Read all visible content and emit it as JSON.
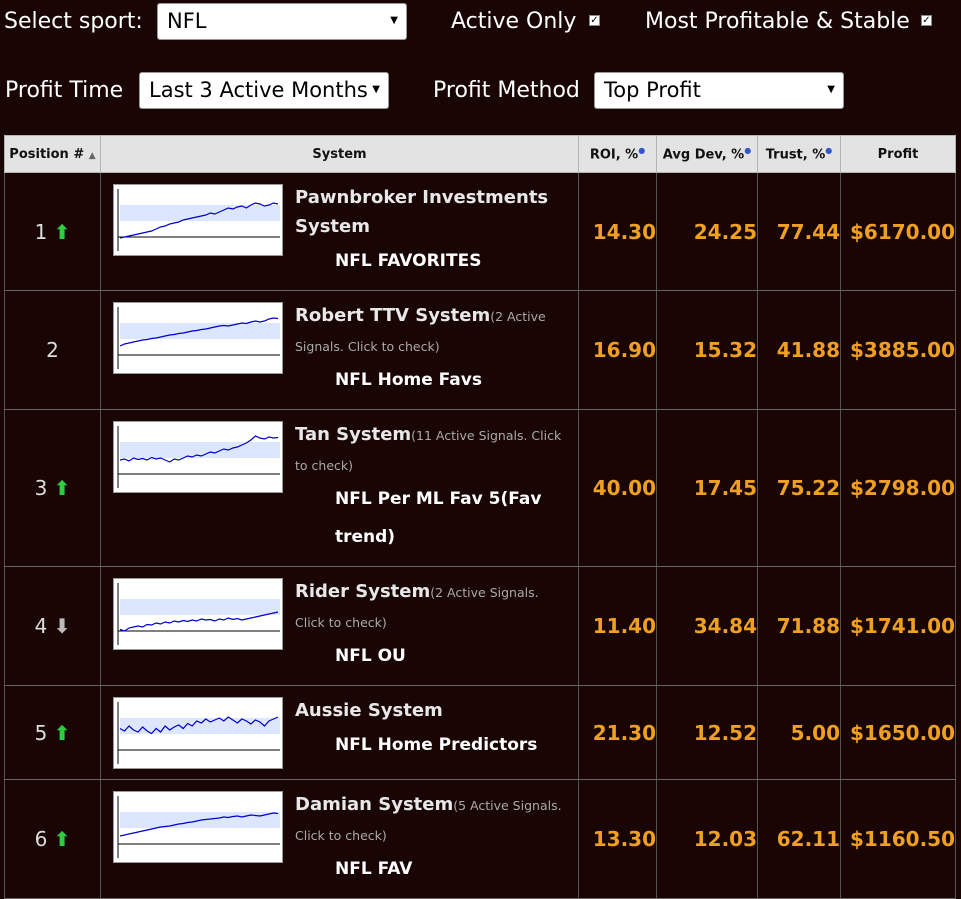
{
  "controls": {
    "select_sport_label": "Select sport:",
    "sport_value": "NFL",
    "active_only_label": "Active Only",
    "active_only_checked": true,
    "most_profitable_label": "Most Profitable & Stable",
    "most_profitable_checked": true,
    "profit_time_label": "Profit Time",
    "profit_time_value": "Last 3 Active Months",
    "profit_method_label": "Profit Method",
    "profit_method_value": "Top Profit"
  },
  "table": {
    "headers": {
      "position": "Position #",
      "system": "System",
      "roi": "ROI, %",
      "avg_dev": "Avg Dev, %",
      "trust": "Trust, %",
      "profit": "Profit"
    },
    "rows": [
      {
        "position": "1",
        "trend": "up",
        "name": "Pawnbroker Investments System",
        "note": "",
        "tag": "NFL FAVORITES",
        "roi": "14.30",
        "avg_dev": "24.25",
        "trust": "77.44",
        "profit": "$6170.00",
        "spark": [
          0.1,
          0.12,
          0.14,
          0.16,
          0.18,
          0.2,
          0.22,
          0.24,
          0.28,
          0.32,
          0.34,
          0.38,
          0.4,
          0.42,
          0.46,
          0.48,
          0.5,
          0.52,
          0.54,
          0.56,
          0.6,
          0.58,
          0.62,
          0.66,
          0.7,
          0.68,
          0.72,
          0.74,
          0.7,
          0.76,
          0.8,
          0.78,
          0.74,
          0.76,
          0.8,
          0.78
        ]
      },
      {
        "position": "2",
        "trend": "",
        "name": "Robert TTV System",
        "note": "(2 Active Signals. Click to check)",
        "tag": "NFL Home Favs",
        "roi": "16.90",
        "avg_dev": "15.32",
        "trust": "41.88",
        "profit": "$3885.00",
        "spark": [
          0.3,
          0.34,
          0.36,
          0.38,
          0.4,
          0.42,
          0.43,
          0.45,
          0.46,
          0.48,
          0.5,
          0.52,
          0.53,
          0.55,
          0.56,
          0.58,
          0.6,
          0.61,
          0.63,
          0.64,
          0.66,
          0.68,
          0.7,
          0.71,
          0.7,
          0.72,
          0.74,
          0.76,
          0.75,
          0.78,
          0.8,
          0.78,
          0.8,
          0.84,
          0.86,
          0.85
        ]
      },
      {
        "position": "3",
        "trend": "up",
        "name": "Tan System",
        "note": "(11 Active Signals. Click to check)",
        "tag": "NFL Per ML Fav 5(Fav trend)",
        "roi": "40.00",
        "avg_dev": "17.45",
        "trust": "75.22",
        "profit": "$2798.00",
        "spark": [
          0.4,
          0.42,
          0.38,
          0.44,
          0.41,
          0.43,
          0.4,
          0.45,
          0.42,
          0.44,
          0.4,
          0.36,
          0.42,
          0.4,
          0.44,
          0.48,
          0.46,
          0.5,
          0.48,
          0.52,
          0.56,
          0.54,
          0.58,
          0.62,
          0.6,
          0.64,
          0.66,
          0.7,
          0.74,
          0.8,
          0.88,
          0.84,
          0.82,
          0.86,
          0.84,
          0.85
        ]
      },
      {
        "position": "4",
        "trend": "down",
        "name": "Rider System",
        "note": "(2 Active Signals. Click to check)",
        "tag": "NFL OU",
        "roi": "11.40",
        "avg_dev": "34.84",
        "trust": "71.88",
        "profit": "$1741.00",
        "spark": [
          0.15,
          0.12,
          0.18,
          0.2,
          0.22,
          0.2,
          0.25,
          0.24,
          0.28,
          0.26,
          0.3,
          0.28,
          0.32,
          0.3,
          0.33,
          0.31,
          0.34,
          0.32,
          0.36,
          0.34,
          0.35,
          0.32,
          0.36,
          0.34,
          0.38,
          0.35,
          0.37,
          0.34,
          0.36,
          0.38,
          0.4,
          0.42,
          0.44,
          0.46,
          0.48,
          0.5
        ]
      },
      {
        "position": "5",
        "trend": "up",
        "name": "Aussie System",
        "note": "",
        "tag": "NFL Home Predictors",
        "roi": "21.30",
        "avg_dev": "12.52",
        "trust": "5.00",
        "profit": "$1650.00",
        "spark": [
          0.55,
          0.5,
          0.6,
          0.52,
          0.48,
          0.58,
          0.5,
          0.45,
          0.55,
          0.48,
          0.6,
          0.52,
          0.58,
          0.62,
          0.55,
          0.65,
          0.6,
          0.7,
          0.66,
          0.74,
          0.68,
          0.72,
          0.76,
          0.7,
          0.78,
          0.72,
          0.66,
          0.74,
          0.7,
          0.64,
          0.72,
          0.68,
          0.6,
          0.7,
          0.74,
          0.78
        ]
      },
      {
        "position": "6",
        "trend": "up",
        "name": "Damian System",
        "note": "(5 Active Signals. Click to check)",
        "tag": "NFL FAV",
        "roi": "13.30",
        "avg_dev": "12.03",
        "trust": "62.11",
        "profit": "$1160.50",
        "spark": [
          0.28,
          0.3,
          0.32,
          0.34,
          0.36,
          0.38,
          0.4,
          0.42,
          0.44,
          0.46,
          0.47,
          0.48,
          0.5,
          0.52,
          0.53,
          0.55,
          0.56,
          0.58,
          0.6,
          0.61,
          0.62,
          0.63,
          0.64,
          0.66,
          0.65,
          0.67,
          0.68,
          0.66,
          0.68,
          0.7,
          0.69,
          0.68,
          0.7,
          0.72,
          0.74,
          0.73
        ]
      }
    ]
  },
  "colors": {
    "background": "#1a0505",
    "number": "#f0a020",
    "up_arrow": "#2ecc40",
    "down_arrow": "#bbbbbb",
    "spark_line": "#0000cc",
    "spark_band": "#dde6ff"
  },
  "icons": {
    "up": "arrow-up-icon",
    "down": "arrow-down-icon",
    "sort": "sort-asc-icon",
    "info": "info-icon",
    "dropdown": "chevron-down-icon"
  }
}
